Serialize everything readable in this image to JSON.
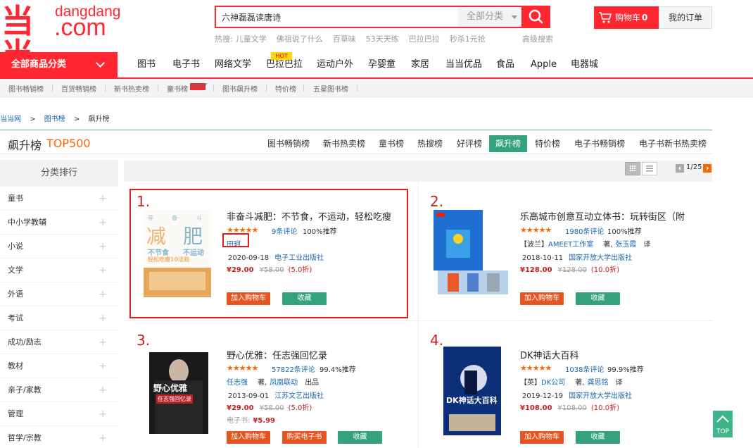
{
  "brand": {
    "mark": "当当",
    "name_en": "dangdang",
    "domain_suffix": ".com",
    "color": "#ff2832"
  },
  "search": {
    "value": "六神磊磊读唐诗",
    "category": "全部分类"
  },
  "hot_words": {
    "label": "热搜:",
    "items": [
      "儿童文学",
      "佛祖说了什么",
      "百草味",
      "53天天练",
      "巴拉巴拉",
      "秒杀1元抢"
    ]
  },
  "advanced_search": "高级搜索",
  "cart": {
    "label": "购物车",
    "count": "0"
  },
  "my_orders": "我的订单",
  "all_categories": "全部商品分类",
  "main_nav": [
    "图书",
    "电子书",
    "网络文学",
    "巴拉巴拉",
    "运动户外",
    "孕婴童",
    "家居",
    "当当优品",
    "食品",
    "Apple",
    "电器城"
  ],
  "hot_tag": "HOT",
  "sub_nav": [
    "图书畅销榜",
    "百货畅销榜",
    "新书热卖榜",
    "童书榜",
    "图书飙升榜",
    "特价榜",
    "五星图书榜"
  ],
  "new_tag": "NEW",
  "breadcrumb": {
    "home": "当当网",
    "sep": ">",
    "books": "图书榜",
    "current": "飙升榜"
  },
  "section": {
    "title": "飙升榜",
    "subtitle": "TOP500"
  },
  "rank_tabs": [
    "图书畅销榜",
    "新书热卖榜",
    "童书榜",
    "热搜榜",
    "好评榜",
    "飙升榜",
    "特价榜",
    "电子书畅销榜",
    "电子书新书热卖榜"
  ],
  "active_tab": "飙升榜",
  "sidebar": {
    "title": "分类排行",
    "items": [
      "童书",
      "中小学教辅",
      "小说",
      "文学",
      "外语",
      "考试",
      "成功/励志",
      "教材",
      "亲子/家教",
      "管理",
      "哲学/宗教"
    ]
  },
  "pagination": "1/25",
  "products": [
    {
      "rank": "1.",
      "title": "非奋斗减肥：不节食，不运动，轻松吃瘦",
      "stars": "★★★★★",
      "reviews": "9条评论",
      "recommend": "100%推荐",
      "author": "田珂",
      "date": "2020-09-18",
      "publisher": "电子工业出版社",
      "price": "¥29.00",
      "original_price": "¥58.00",
      "discount": "(5.0折)",
      "add_cart": "加入购物车",
      "favorite": "收藏",
      "cover_text": [
        "非",
        "奋",
        "斗",
        "减",
        "肥",
        "不节食",
        "不运动",
        "轻松吃瘦10法则"
      ]
    },
    {
      "rank": "2.",
      "title": "乐高城市创意互动立体书：玩转街区（附",
      "stars": "★★★★★",
      "reviews": "1980条评论",
      "recommend": "100%推荐",
      "author_prefix": "【波兰】",
      "author": "AMEET工作室",
      "author_role": "著,",
      "translator": "张玉霞",
      "translator_role": "译",
      "date": "2018-10-11",
      "publisher": "国家开放大学出版社",
      "price": "¥128.00",
      "original_price": "¥128.00",
      "discount": "(10.0折)",
      "add_cart": "加入购物车",
      "favorite": "收藏"
    },
    {
      "rank": "3.",
      "title": "野心优雅：任志强回忆录",
      "stars": "★★★★★",
      "reviews": "57822条评论",
      "recommend": "99.4%推荐",
      "author": "任志强",
      "author_role": "著,",
      "translator": "凤凰联动",
      "translator_role": "出品",
      "date": "2013-09-01",
      "publisher": "江苏文艺出版社",
      "price": "¥29.00",
      "original_price": "¥58.00",
      "discount": "(5.0折)",
      "ebook_label": "电子书:",
      "ebook_price": "¥5.99",
      "add_cart": "加入购物车",
      "buy_ebook": "购买电子书",
      "favorite": "收藏",
      "cover_text": [
        "野心优雅",
        "任志强回忆录"
      ]
    },
    {
      "rank": "4.",
      "title": "DK神话大百科",
      "stars": "★★★★★",
      "reviews": "1038条评论",
      "recommend": "99.9%推荐",
      "author_prefix": "【英】",
      "author": "DK公司",
      "author_role": "著,",
      "translator": "龚思铭",
      "translator_role": "译",
      "date": "2019-12-19",
      "publisher": "国家开放大学出版社",
      "price": "¥108.00",
      "original_price": "¥108.00",
      "discount": "(10.0折)",
      "add_cart": "加入购物车",
      "favorite": "收藏",
      "cover_text": [
        "DK神话大百科"
      ]
    }
  ],
  "back_to_top": "TOP"
}
